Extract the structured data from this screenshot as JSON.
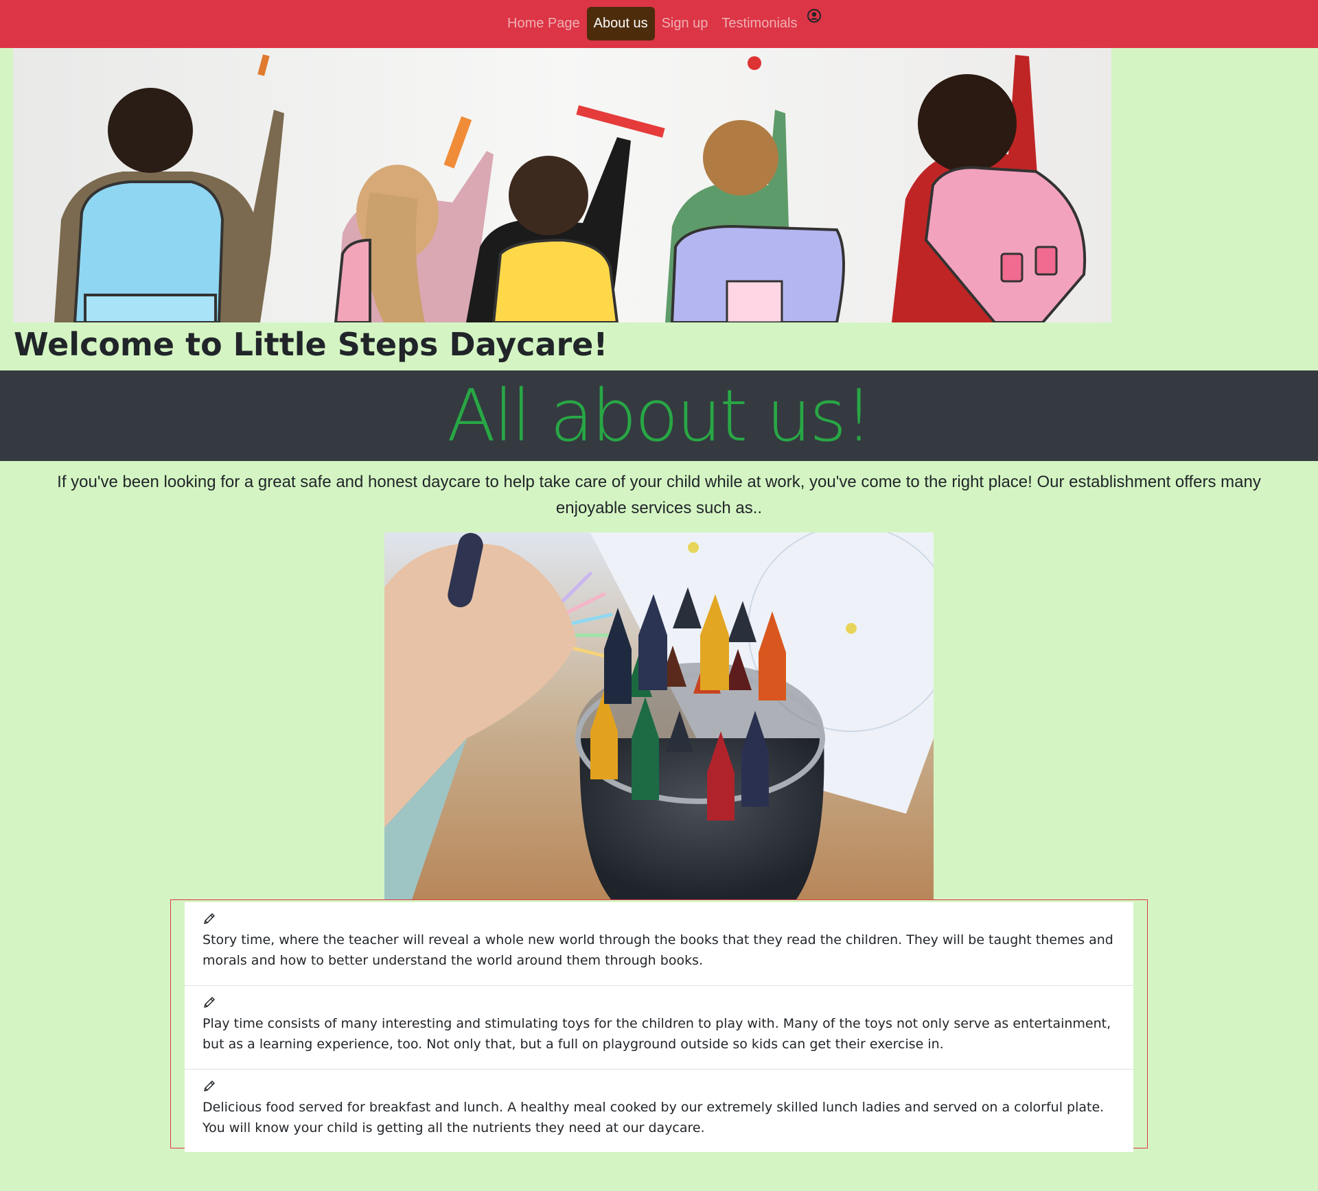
{
  "nav": {
    "items": [
      {
        "label": "Home Page",
        "active": false
      },
      {
        "label": "About us",
        "active": true
      },
      {
        "label": "Sign up",
        "active": false
      },
      {
        "label": "Testimonials",
        "active": false
      }
    ],
    "user_icon": "user-circle-icon",
    "bg_color": "#dc3545",
    "active_bg_color": "#4d2c0b"
  },
  "hero": {
    "image": "children-drawing-with-backpacks-photo"
  },
  "welcome_heading": "Welcome to Little Steps Daycare!",
  "about": {
    "title": "All about us!",
    "title_color": "#28a745",
    "band_color": "#343a40",
    "intro": "If you've been looking for a great safe and honest daycare to help take care of your child while at work, you've come to the right place! Our establishment offers many enjoyable services such as.."
  },
  "photo": {
    "image": "crayon-jar-photo"
  },
  "services": [
    {
      "icon": "pencil-icon",
      "text": "Story time, where the teacher will reveal a whole new world through the books that they read the children. They will be taught themes and morals and how to better understand the world around them through books."
    },
    {
      "icon": "pencil-icon",
      "text": "Play time consists of many interesting and stimulating toys for the children to play with. Many of the toys not only serve as entertainment, but as a learning experience, too. Not only that, but a full on playground outside so kids can get their exercise in."
    },
    {
      "icon": "pencil-icon",
      "text": "Delicious food served for breakfast and lunch. A healthy meal cooked by our extremely skilled lunch ladies and served on a colorful plate. You will know your child is getting all the nutrients they need at our daycare."
    }
  ],
  "page_bg_color": "#d4f5c3"
}
